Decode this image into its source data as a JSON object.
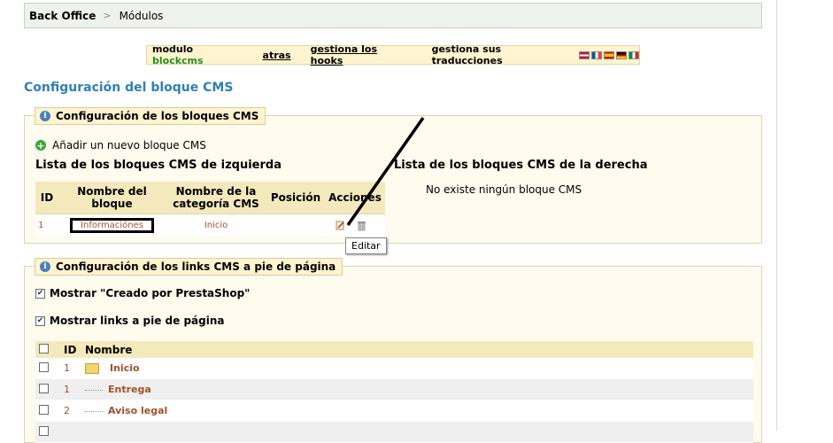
{
  "breadcrumb": {
    "root": "Back Office",
    "current": "Módulos"
  },
  "module_bar": {
    "prefix": "modulo ",
    "module_name": "blockcms",
    "back": "atras",
    "hooks": "gestiona los hooks",
    "translations": "gestiona sus traducciones"
  },
  "page_title": "Configuración del bloque CMS",
  "blocks_section": {
    "legend": "Configuración de los bloques CMS",
    "add_label": "Añadir un nuevo bloque CMS",
    "left_title": "Lista de los bloques CMS de izquierda",
    "right_title": "Lista de los bloques CMS de la derecha",
    "right_empty": "No existe ningún bloque CMS",
    "table_headers": [
      "ID",
      "Nombre del bloque",
      "Nombre de la categoría CMS",
      "Posición",
      "Acciones"
    ],
    "rows": [
      {
        "id": "1",
        "name": "Informaciónes",
        "category": "Inicio"
      }
    ],
    "tooltip": "Editar"
  },
  "footer_section": {
    "legend": "Configuración de los links CMS a pie de página",
    "option_created_by": "Mostrar \"Creado por PrestaShop\"",
    "option_footer_links": "Mostrar links a pie de página",
    "table_headers": [
      "ID",
      "Nombre"
    ],
    "rows": [
      {
        "id": "1",
        "name": "Inicio"
      },
      {
        "id": "1",
        "name": "Entrega"
      },
      {
        "id": "2",
        "name": "Aviso legal"
      }
    ]
  },
  "colors": {
    "accent": "#2f7fb8",
    "module_green": "#268c26",
    "link_brown": "#a0522d"
  },
  "icons": [
    "info-icon",
    "add-icon",
    "edit-icon",
    "trash-icon",
    "folder-icon",
    "checkbox-icon",
    "flag-icon"
  ]
}
